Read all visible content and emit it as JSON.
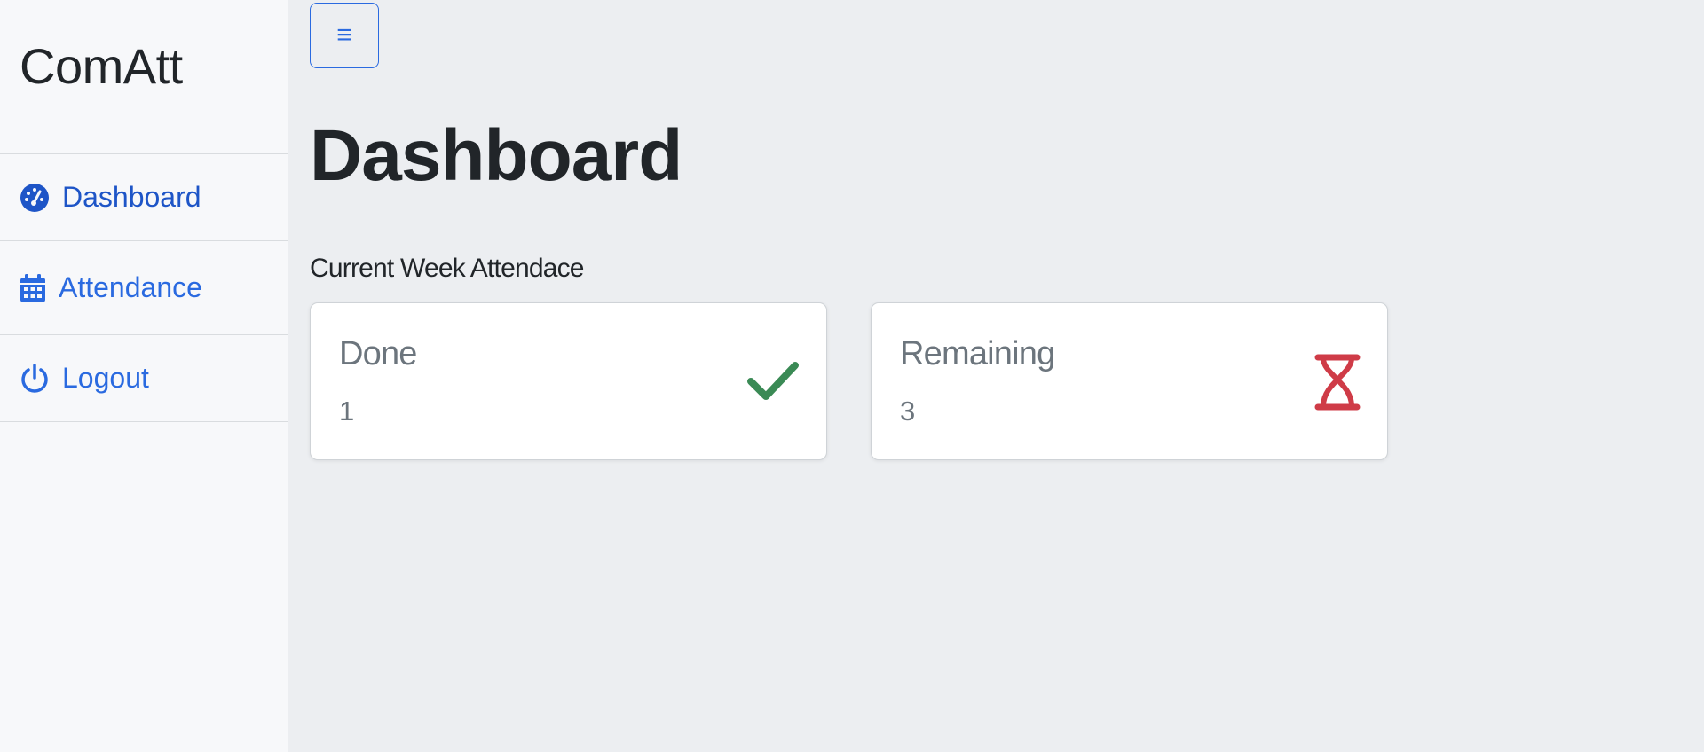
{
  "sidebar": {
    "brand": "ComAtt",
    "items": [
      {
        "label": "Dashboard",
        "icon": "speedometer-icon",
        "active": true
      },
      {
        "label": "Attendance",
        "icon": "calendar-icon"
      },
      {
        "label": "Logout",
        "icon": "power-icon"
      }
    ]
  },
  "header": {
    "toggle_label": "≡"
  },
  "main": {
    "title": "Dashboard",
    "section_label": "Current Week Attendace",
    "cards": [
      {
        "title": "Done",
        "value": "1",
        "icon": "check-icon",
        "icon_color": "#3a8a55"
      },
      {
        "title": "Remaining",
        "value": "3",
        "icon": "hourglass-icon",
        "icon_color": "#cf3b47"
      }
    ]
  },
  "colors": {
    "accent": "#2a6ae0",
    "sidebar_bg": "#f7f8fa",
    "main_bg": "#eceef1"
  }
}
